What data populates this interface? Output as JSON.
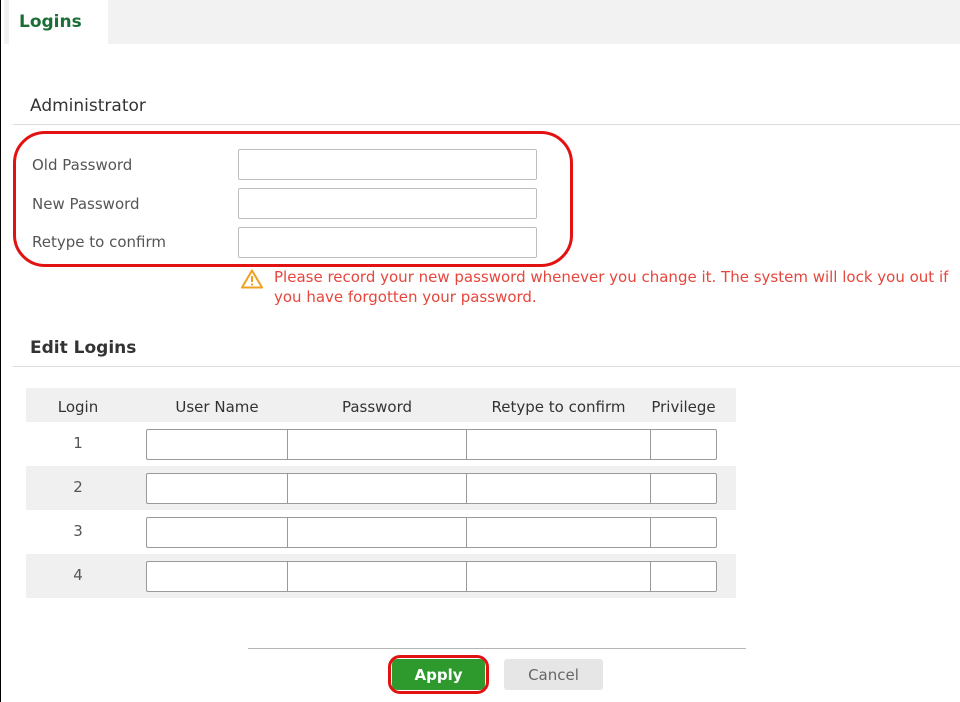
{
  "tabs": [
    {
      "label": "Logins",
      "active": true
    }
  ],
  "administrator": {
    "title": "Administrator",
    "fields": [
      {
        "label": "Old Password",
        "value": ""
      },
      {
        "label": "New Password",
        "value": ""
      },
      {
        "label": "Retype to confirm",
        "value": ""
      }
    ],
    "warning": "Please record your new password whenever you change it. The system will lock you out if you have forgotten your password.",
    "warning_icon": "warning-triangle-icon"
  },
  "edit_logins": {
    "title": "Edit Logins",
    "columns": [
      "Login",
      "User Name",
      "Password",
      "Retype to confirm",
      "Privilege"
    ],
    "rows": [
      {
        "login": "1",
        "user_name": "",
        "password": "",
        "retype": "",
        "privilege": ""
      },
      {
        "login": "2",
        "user_name": "",
        "password": "",
        "retype": "",
        "privilege": ""
      },
      {
        "login": "3",
        "user_name": "",
        "password": "",
        "retype": "",
        "privilege": ""
      },
      {
        "login": "4",
        "user_name": "",
        "password": "",
        "retype": "",
        "privilege": ""
      }
    ]
  },
  "buttons": {
    "apply": "Apply",
    "cancel": "Cancel"
  },
  "colors": {
    "accent_green": "#2e9a2e",
    "tab_text_green": "#1a6e36",
    "warning_text": "#e6463c",
    "highlight_red": "#e21212"
  }
}
